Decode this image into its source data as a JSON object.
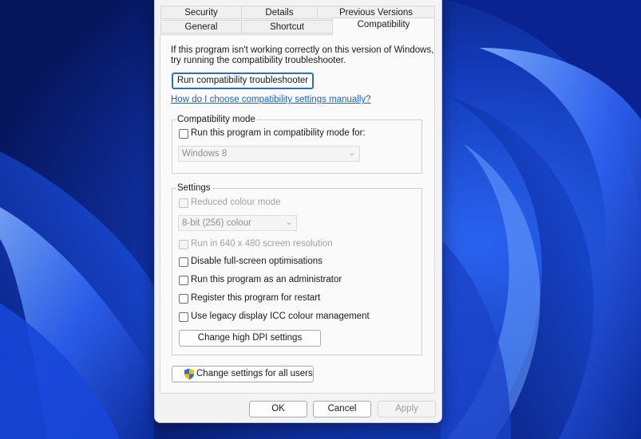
{
  "tabs_row1": [
    {
      "label": "Security"
    },
    {
      "label": "Details"
    },
    {
      "label": "Previous Versions"
    }
  ],
  "tabs_row2": [
    {
      "label": "General"
    },
    {
      "label": "Shortcut"
    },
    {
      "label": "Compatibility",
      "active": true
    }
  ],
  "intro": {
    "line1": "If this program isn't working correctly on this version of Windows,",
    "line2": "try running the compatibility troubleshooter."
  },
  "troubleshooter_button": "Run compatibility troubleshooter",
  "help_link": "How do I choose compatibility settings manually?",
  "compat_mode": {
    "legend": "Compatibility mode",
    "checkbox_label": "Run this program in compatibility mode for:",
    "checked": false,
    "os_select_value": "Windows 8"
  },
  "settings": {
    "legend": "Settings",
    "reduced_colour_label": "Reduced colour mode",
    "colour_select_value": "8-bit (256) colour",
    "run_640_label": "Run in 640 x 480 screen resolution",
    "disable_fullscreen_label": "Disable full-screen optimisations",
    "run_admin_label": "Run this program as an administrator",
    "register_restart_label": "Register this program for restart",
    "legacy_icc_label": "Use legacy display ICC colour management",
    "dpi_button": "Change high DPI settings"
  },
  "all_users_button": "Change settings for all users",
  "footer": {
    "ok": "OK",
    "cancel": "Cancel",
    "apply": "Apply"
  },
  "colors": {
    "accent": "#2a6fbf",
    "link": "#1d63b5",
    "wallpaper_dark": "#0a1f6e",
    "wallpaper_light": "#3f7bff"
  },
  "icons": {
    "shield": "uac-shield-icon",
    "dropdown": "chevron-down-icon"
  }
}
